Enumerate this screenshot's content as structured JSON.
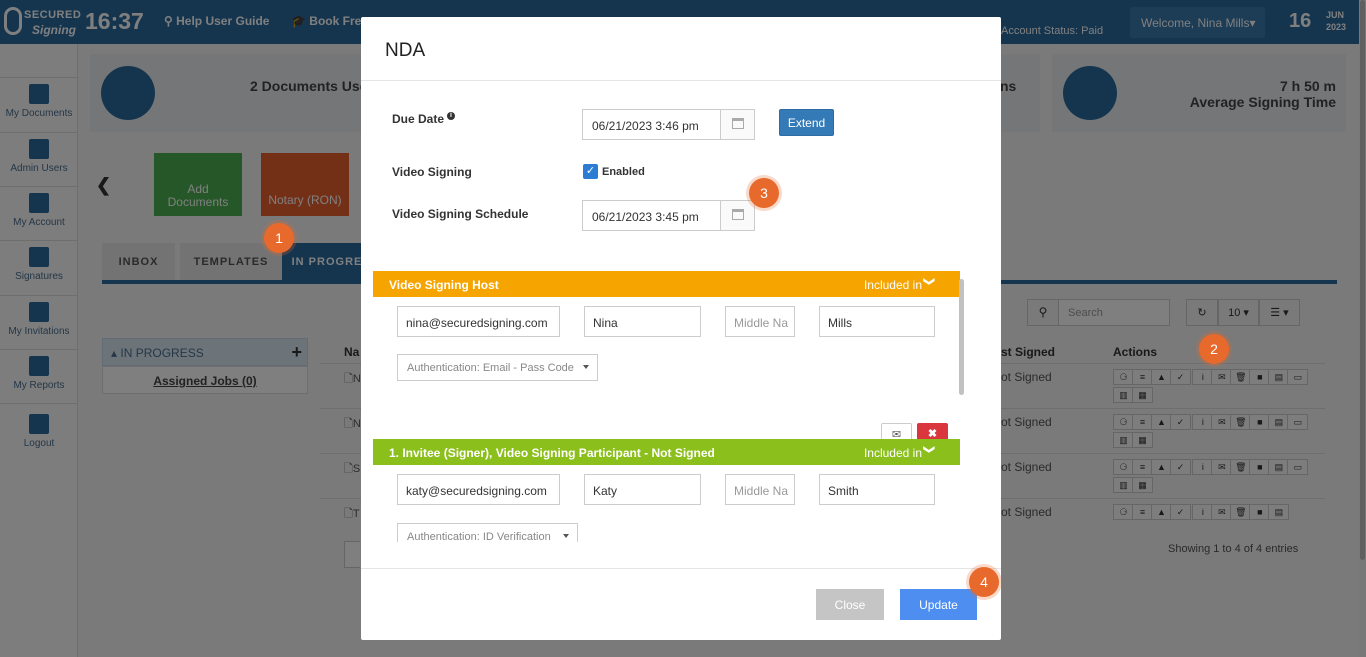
{
  "topbar": {
    "logo_top": "SECURED",
    "logo_bottom": "Signing",
    "clock": "16:37",
    "nav": [
      "Help User Guide",
      "Book Fre"
    ],
    "account_status": "Account Status: Paid",
    "welcome": "Welcome,  Nina Mills",
    "date_day": "16",
    "date_month": "JUN",
    "date_year": "2023"
  },
  "sidebar": {
    "items": [
      {
        "label": "My Documents",
        "icon": "document-icon"
      },
      {
        "label": "Admin Users",
        "icon": "user-icon"
      },
      {
        "label": "My Account",
        "icon": "gear-icon"
      },
      {
        "label": "Signatures",
        "icon": "pen-icon"
      },
      {
        "label": "My Invitations",
        "icon": "envelope-icon"
      },
      {
        "label": "My Reports",
        "icon": "bar-chart-icon"
      },
      {
        "label": "Logout",
        "icon": "lock-icon"
      }
    ]
  },
  "stats": {
    "docs_used": "2 Documents Use",
    "ns": "ns",
    "time_value": "7 h 50 m",
    "time_label": "Average Signing Time"
  },
  "actions": {
    "add_line1": "Add",
    "add_line2": "Documents",
    "notary": "Notary (RON)"
  },
  "tabs": [
    "INBOX",
    "TEMPLATES",
    "IN PROGRE"
  ],
  "inprogress": {
    "header": "IN PROGRESS",
    "assigned": "Assigned Jobs (0)"
  },
  "table": {
    "search_placeholder": "Search",
    "page_size": "10",
    "col_name": "Na",
    "col_signed": "st Signed",
    "col_actions": "Actions",
    "rows": [
      {
        "initial": "N",
        "status": "ot Signed"
      },
      {
        "initial": "N",
        "status": "ot Signed"
      },
      {
        "initial": "S",
        "status": "ot Signed"
      },
      {
        "initial": "T",
        "status": "ot Signed"
      }
    ],
    "showing": "Showing 1 to 4 of 4 entries"
  },
  "modal": {
    "title": "NDA",
    "due_date_label": "Due Date",
    "due_date_value": "06/21/2023 3:46 pm",
    "extend": "Extend",
    "video_signing_label": "Video Signing",
    "video_enabled_label": "Enabled",
    "video_enabled": true,
    "schedule_label": "Video Signing Schedule",
    "schedule_value": "06/21/2023 3:45 pm",
    "host": {
      "header": "Video Signing Host",
      "included": "Included in",
      "email": "nina@securedsigning.com",
      "first": "Nina",
      "middle_placeholder": "Middle Na",
      "last": "Mills",
      "auth": "Authentication: Email - Pass Code"
    },
    "invitee": {
      "header": "1.  Invitee (Signer), Video Signing Participant - Not Signed",
      "included": "Included in",
      "email": "katy@securedsigning.com",
      "first": "Katy",
      "middle_placeholder": "Middle Na",
      "last": "Smith",
      "auth": "Authentication: ID Verification"
    },
    "close": "Close",
    "update": "Update"
  },
  "badges": [
    "1",
    "2",
    "3",
    "4"
  ],
  "colors": {
    "brand_blue": "#2b6a9e",
    "host_bar": "#f5a400",
    "invitee_bar": "#8bbf1c",
    "badge": "#e8692c",
    "update": "#4d8ef0"
  }
}
